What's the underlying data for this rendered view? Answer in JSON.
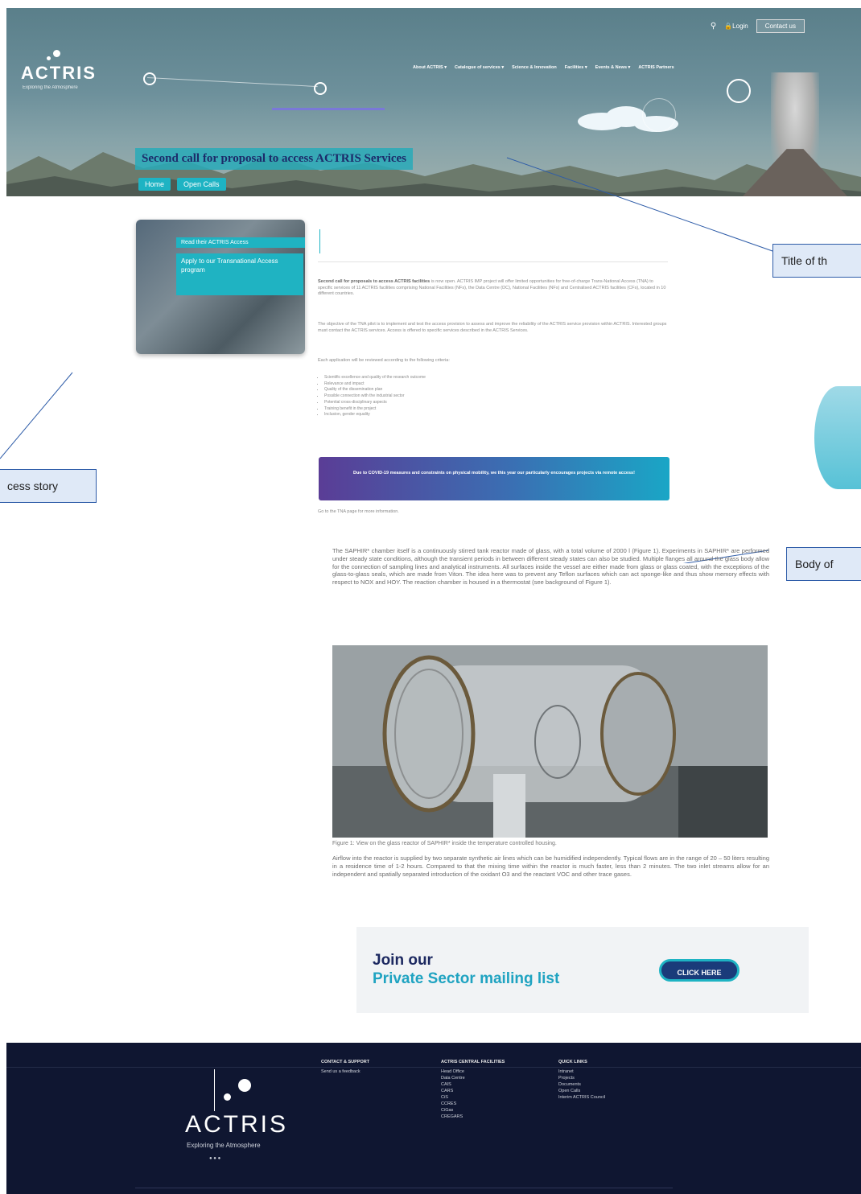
{
  "header": {
    "logo_text": "ACTRIS",
    "logo_tagline": "Exploring the Atmosphere",
    "search_icon": "search-icon",
    "login_label": "Login",
    "contact_label": "Contact us",
    "nav": [
      "About ACTRIS ▾",
      "Catalogue of services ▾",
      "Science & Innovation",
      "Facilities ▾",
      "Events & News ▾",
      "ACTRIS Partners"
    ],
    "page_title": "Second call for proposal to access ACTRIS Services",
    "breadcrumb": [
      "Home",
      "Open Calls"
    ]
  },
  "annotations": {
    "title": "Title of th",
    "story": "cess story",
    "body": "Body of"
  },
  "sidebar": {
    "story_label": "Read their ACTRIS Access",
    "story_title": "Apply to our Transnational Access program"
  },
  "content": {
    "intro_bold": "Second call for proposals to access ACTRIS facilities",
    "intro_rest": " is now open. ACTRIS IMP project will offer limited opportunities for free-of-charge Trans-National Access (TNA) to specific services of 11 ACTRIS facilities comprising National Facilities (NFs), the Data Centre (DC), National Facilities (NFs) and Centralised ACTRIS facilities (CFs), located in 10 different countries.",
    "para2": "The objective of the TNA pilot is to implement and test the access provision to assess and improve the reliability of the ACTRIS service provision within ACTRIS. Interested groups must contact the ACTRIS services. Access is offered to specific services described in the ACTRIS Services.",
    "para3": "Each application will be reviewed according to the following criteria:",
    "criteria": [
      "Scientific excellence and quality of the research outcome",
      "Relevance and impact",
      "Quality of the dissemination plan",
      "Possible connection with the industrial sector",
      "Potential cross-disciplinary aspects",
      "Training benefit in the project",
      "Inclusion, gender equality"
    ],
    "banner": "Due to COVID-19 measures and constraints on physical mobility, we this year our particularly encourages projects via remote access!",
    "more_info": "Go to the TNA page for more information.",
    "body_para": "The SAPHIR* chamber itself is a continuously stirred tank reactor made of glass, with a total volume of 2000 l (Figure 1). Experiments in SAPHIR* are performed under steady state conditions, although the transient periods in between different steady states can also be studied. Multiple flanges all around the glass body allow for the connection of sampling lines and analytical instruments. All surfaces inside the vessel are either made from glass or glass coated, with the exceptions of the glass-to-glass seals, which are made from Viton. The idea here was to prevent any Teflon surfaces which can act sponge-like and thus show memory effects with respect to NOX and HOY. The reaction chamber is housed in a thermostat (see background of Figure 1).",
    "figure_caption": "Figure 1: View on the glass reactor of SAPHIR* inside the temperature controlled housing.",
    "body_para2": "Airflow into the reactor is supplied by two separate synthetic air lines which can be humidified independently. Typical flows are in the range of 20 – 50 liters resulting in a residence time of 1-2 hours. Compared to that the mixing time within the reactor is much faster, less than 2 minutes. The two inlet streams allow for an independent and spatially separated introduction of the oxidant O3 and the reactant VOC and other trace gases."
  },
  "mailing": {
    "line1": "Join our",
    "line2": "Private Sector mailing list",
    "button": "CLICK HERE"
  },
  "footer": {
    "logo_text": "ACTRIS",
    "logo_tagline": "Exploring the Atmosphere",
    "contact_heading": "CONTACT & SUPPORT",
    "contact_link": "Send us a feedback",
    "central_heading": "ACTRIS CENTRAL FACILITIES",
    "central_items": [
      "Head Office",
      "Data Centre",
      "CAIS",
      "CARS",
      "CiS",
      "CCRES",
      "CiGas",
      "CREGARS"
    ],
    "quick_heading": "QUICK LINKS",
    "quick_items": [
      "Intranet",
      "Projects",
      "Documents",
      "Open Calls",
      "Interim ACTRIS Council"
    ],
    "social": "● ● ●"
  }
}
